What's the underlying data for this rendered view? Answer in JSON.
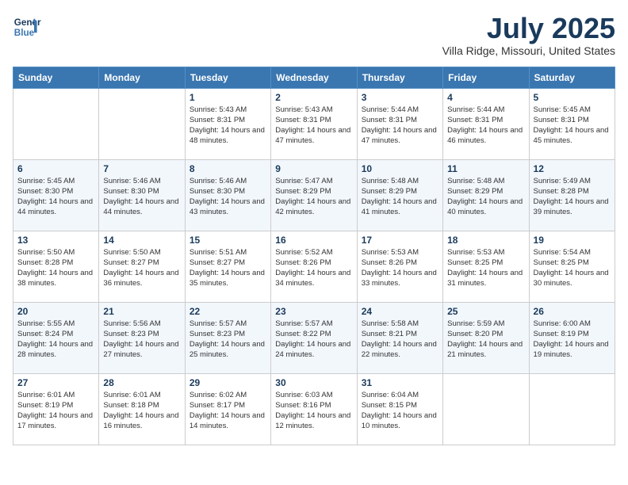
{
  "header": {
    "logo_line1": "General",
    "logo_line2": "Blue",
    "month": "July 2025",
    "location": "Villa Ridge, Missouri, United States"
  },
  "weekdays": [
    "Sunday",
    "Monday",
    "Tuesday",
    "Wednesday",
    "Thursday",
    "Friday",
    "Saturday"
  ],
  "weeks": [
    [
      {
        "day": "",
        "sunrise": "",
        "sunset": "",
        "daylight": ""
      },
      {
        "day": "",
        "sunrise": "",
        "sunset": "",
        "daylight": ""
      },
      {
        "day": "1",
        "sunrise": "Sunrise: 5:43 AM",
        "sunset": "Sunset: 8:31 PM",
        "daylight": "Daylight: 14 hours and 48 minutes."
      },
      {
        "day": "2",
        "sunrise": "Sunrise: 5:43 AM",
        "sunset": "Sunset: 8:31 PM",
        "daylight": "Daylight: 14 hours and 47 minutes."
      },
      {
        "day": "3",
        "sunrise": "Sunrise: 5:44 AM",
        "sunset": "Sunset: 8:31 PM",
        "daylight": "Daylight: 14 hours and 47 minutes."
      },
      {
        "day": "4",
        "sunrise": "Sunrise: 5:44 AM",
        "sunset": "Sunset: 8:31 PM",
        "daylight": "Daylight: 14 hours and 46 minutes."
      },
      {
        "day": "5",
        "sunrise": "Sunrise: 5:45 AM",
        "sunset": "Sunset: 8:31 PM",
        "daylight": "Daylight: 14 hours and 45 minutes."
      }
    ],
    [
      {
        "day": "6",
        "sunrise": "Sunrise: 5:45 AM",
        "sunset": "Sunset: 8:30 PM",
        "daylight": "Daylight: 14 hours and 44 minutes."
      },
      {
        "day": "7",
        "sunrise": "Sunrise: 5:46 AM",
        "sunset": "Sunset: 8:30 PM",
        "daylight": "Daylight: 14 hours and 44 minutes."
      },
      {
        "day": "8",
        "sunrise": "Sunrise: 5:46 AM",
        "sunset": "Sunset: 8:30 PM",
        "daylight": "Daylight: 14 hours and 43 minutes."
      },
      {
        "day": "9",
        "sunrise": "Sunrise: 5:47 AM",
        "sunset": "Sunset: 8:29 PM",
        "daylight": "Daylight: 14 hours and 42 minutes."
      },
      {
        "day": "10",
        "sunrise": "Sunrise: 5:48 AM",
        "sunset": "Sunset: 8:29 PM",
        "daylight": "Daylight: 14 hours and 41 minutes."
      },
      {
        "day": "11",
        "sunrise": "Sunrise: 5:48 AM",
        "sunset": "Sunset: 8:29 PM",
        "daylight": "Daylight: 14 hours and 40 minutes."
      },
      {
        "day": "12",
        "sunrise": "Sunrise: 5:49 AM",
        "sunset": "Sunset: 8:28 PM",
        "daylight": "Daylight: 14 hours and 39 minutes."
      }
    ],
    [
      {
        "day": "13",
        "sunrise": "Sunrise: 5:50 AM",
        "sunset": "Sunset: 8:28 PM",
        "daylight": "Daylight: 14 hours and 38 minutes."
      },
      {
        "day": "14",
        "sunrise": "Sunrise: 5:50 AM",
        "sunset": "Sunset: 8:27 PM",
        "daylight": "Daylight: 14 hours and 36 minutes."
      },
      {
        "day": "15",
        "sunrise": "Sunrise: 5:51 AM",
        "sunset": "Sunset: 8:27 PM",
        "daylight": "Daylight: 14 hours and 35 minutes."
      },
      {
        "day": "16",
        "sunrise": "Sunrise: 5:52 AM",
        "sunset": "Sunset: 8:26 PM",
        "daylight": "Daylight: 14 hours and 34 minutes."
      },
      {
        "day": "17",
        "sunrise": "Sunrise: 5:53 AM",
        "sunset": "Sunset: 8:26 PM",
        "daylight": "Daylight: 14 hours and 33 minutes."
      },
      {
        "day": "18",
        "sunrise": "Sunrise: 5:53 AM",
        "sunset": "Sunset: 8:25 PM",
        "daylight": "Daylight: 14 hours and 31 minutes."
      },
      {
        "day": "19",
        "sunrise": "Sunrise: 5:54 AM",
        "sunset": "Sunset: 8:25 PM",
        "daylight": "Daylight: 14 hours and 30 minutes."
      }
    ],
    [
      {
        "day": "20",
        "sunrise": "Sunrise: 5:55 AM",
        "sunset": "Sunset: 8:24 PM",
        "daylight": "Daylight: 14 hours and 28 minutes."
      },
      {
        "day": "21",
        "sunrise": "Sunrise: 5:56 AM",
        "sunset": "Sunset: 8:23 PM",
        "daylight": "Daylight: 14 hours and 27 minutes."
      },
      {
        "day": "22",
        "sunrise": "Sunrise: 5:57 AM",
        "sunset": "Sunset: 8:23 PM",
        "daylight": "Daylight: 14 hours and 25 minutes."
      },
      {
        "day": "23",
        "sunrise": "Sunrise: 5:57 AM",
        "sunset": "Sunset: 8:22 PM",
        "daylight": "Daylight: 14 hours and 24 minutes."
      },
      {
        "day": "24",
        "sunrise": "Sunrise: 5:58 AM",
        "sunset": "Sunset: 8:21 PM",
        "daylight": "Daylight: 14 hours and 22 minutes."
      },
      {
        "day": "25",
        "sunrise": "Sunrise: 5:59 AM",
        "sunset": "Sunset: 8:20 PM",
        "daylight": "Daylight: 14 hours and 21 minutes."
      },
      {
        "day": "26",
        "sunrise": "Sunrise: 6:00 AM",
        "sunset": "Sunset: 8:19 PM",
        "daylight": "Daylight: 14 hours and 19 minutes."
      }
    ],
    [
      {
        "day": "27",
        "sunrise": "Sunrise: 6:01 AM",
        "sunset": "Sunset: 8:19 PM",
        "daylight": "Daylight: 14 hours and 17 minutes."
      },
      {
        "day": "28",
        "sunrise": "Sunrise: 6:01 AM",
        "sunset": "Sunset: 8:18 PM",
        "daylight": "Daylight: 14 hours and 16 minutes."
      },
      {
        "day": "29",
        "sunrise": "Sunrise: 6:02 AM",
        "sunset": "Sunset: 8:17 PM",
        "daylight": "Daylight: 14 hours and 14 minutes."
      },
      {
        "day": "30",
        "sunrise": "Sunrise: 6:03 AM",
        "sunset": "Sunset: 8:16 PM",
        "daylight": "Daylight: 14 hours and 12 minutes."
      },
      {
        "day": "31",
        "sunrise": "Sunrise: 6:04 AM",
        "sunset": "Sunset: 8:15 PM",
        "daylight": "Daylight: 14 hours and 10 minutes."
      },
      {
        "day": "",
        "sunrise": "",
        "sunset": "",
        "daylight": ""
      },
      {
        "day": "",
        "sunrise": "",
        "sunset": "",
        "daylight": ""
      }
    ]
  ]
}
